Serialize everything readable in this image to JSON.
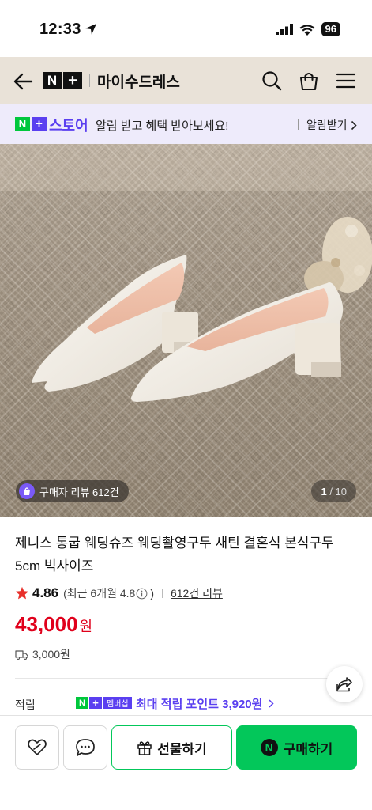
{
  "status": {
    "time": "12:33",
    "battery": "96"
  },
  "header": {
    "brand_n": "N",
    "brand_plus": "+",
    "store_name": "마이수드레스"
  },
  "promo": {
    "brand": "스토어",
    "text": "알림 받고 혜택 받아보세요!",
    "cta": "알림받기"
  },
  "gallery": {
    "review_badge": "구매자 리뷰 612건",
    "current": "1",
    "total": "/ 10"
  },
  "product": {
    "title": "제니스 통굽 웨딩슈즈 웨딩촬영구두 새틴 결혼식 본식구두 5cm 빅사이즈",
    "rating": "4.86",
    "recent_rating": "(최근 6개월 4.8",
    "recent_close": ")",
    "review_count": "612건 리뷰",
    "price": "43,000",
    "currency": "원",
    "shipping": "3,000원",
    "points_label": "적립",
    "membership": "멤버십",
    "points_text": "최대 적립 포인트 3,920원"
  },
  "actions": {
    "gift": "선물하기",
    "buy": "구매하기",
    "buy_logo": "N"
  },
  "colors": {
    "accent_green": "#03c75a",
    "accent_purple": "#5a3ff0",
    "price_red": "#e0001b",
    "header_bg": "#e9e2d8"
  }
}
